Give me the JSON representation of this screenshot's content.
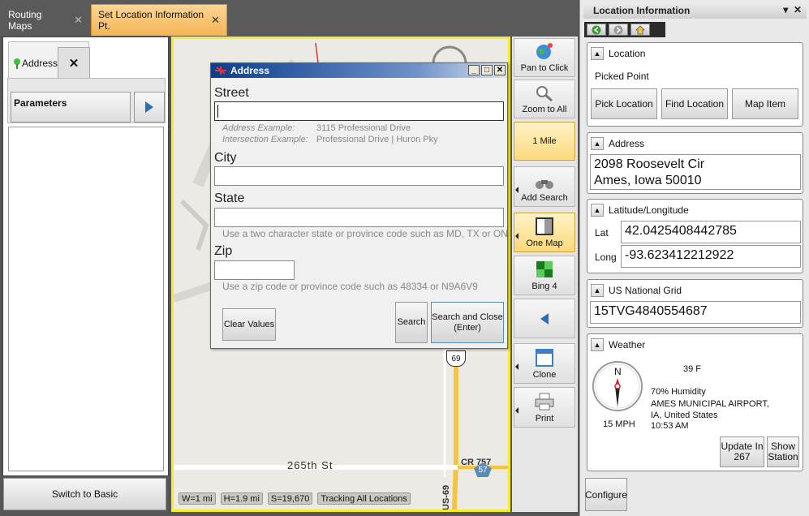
{
  "tabs": [
    {
      "label": "Routing Maps",
      "active": false
    },
    {
      "label": "Set Location Information Pt.",
      "active": true
    }
  ],
  "left_panel": {
    "tab_label": "Address",
    "close_label": "✕",
    "parameters_label": "Parameters",
    "switch_label": "Switch to Basic"
  },
  "map": {
    "road_label": "265th St",
    "shield_69": "69",
    "shield_57": "57",
    "cr_label": "CR 757",
    "us_label": "US-69",
    "status": [
      "W=1 mi",
      "H=1.9 mi",
      "S=19,670",
      "Tracking All Locations"
    ]
  },
  "dialog": {
    "title": "Address",
    "street_label": "Street",
    "street_value": "",
    "address_example_key": "Address Example:",
    "address_example_val": "3115 Professional Drive",
    "intersection_example_key": "Intersection Example:",
    "intersection_example_val": "Professional Drive | Huron Pky",
    "city_label": "City",
    "city_value": "",
    "state_label": "State",
    "state_value": "",
    "state_hint": "Use a two character state or province code such as MD, TX or ON",
    "zip_label": "Zip",
    "zip_value": "",
    "zip_hint": "Use a zip code or province code such as 48334 or N9A6V9",
    "clear_label": "Clear Values",
    "search_label": "Search",
    "search_close_label": "Search and Close (Enter)"
  },
  "toolbar": {
    "pan_label": "Pan to Click",
    "zoom_label": "Zoom to All",
    "scale_label": "1 Mile",
    "add_search_label": "Add Search",
    "one_map_label": "One Map",
    "bing_label": "Bing 4",
    "clone_label": "Clone",
    "print_label": "Print"
  },
  "right_panel": {
    "title": "Location Information",
    "location": {
      "header": "Location",
      "value": "Picked Point",
      "pick_label": "Pick Location",
      "find_label": "Find Location",
      "map_item_label": "Map Item"
    },
    "address": {
      "header": "Address",
      "line1": "2098 Roosevelt Cir",
      "line2": "Ames, Iowa  50010"
    },
    "latlong": {
      "header": "Latitude/Longitude",
      "lat_label": "Lat",
      "lat_value": "42.0425408442785",
      "long_label": "Long",
      "long_value": "-93.623412212922"
    },
    "usng": {
      "header": "US National Grid",
      "value": "15TVG4840554687"
    },
    "weather": {
      "header": "Weather",
      "compass_n": "N",
      "wind": "15 MPH",
      "temp": "39 F",
      "humidity": "70% Humidity",
      "station_line1": "AMES MUNICIPAL AIRPORT,",
      "station_line2": "IA, United States",
      "time": "10:53 AM",
      "update_label": "Update In 267",
      "show_station_label": "Show Station"
    },
    "configure_label": "Configure"
  },
  "colors": {
    "active_tab": "#f4b555",
    "map_border": "#f5eb2a",
    "dialog_title": "#0b3d8c",
    "highlight_button": "#fbd97a",
    "road": "#f5c542"
  }
}
